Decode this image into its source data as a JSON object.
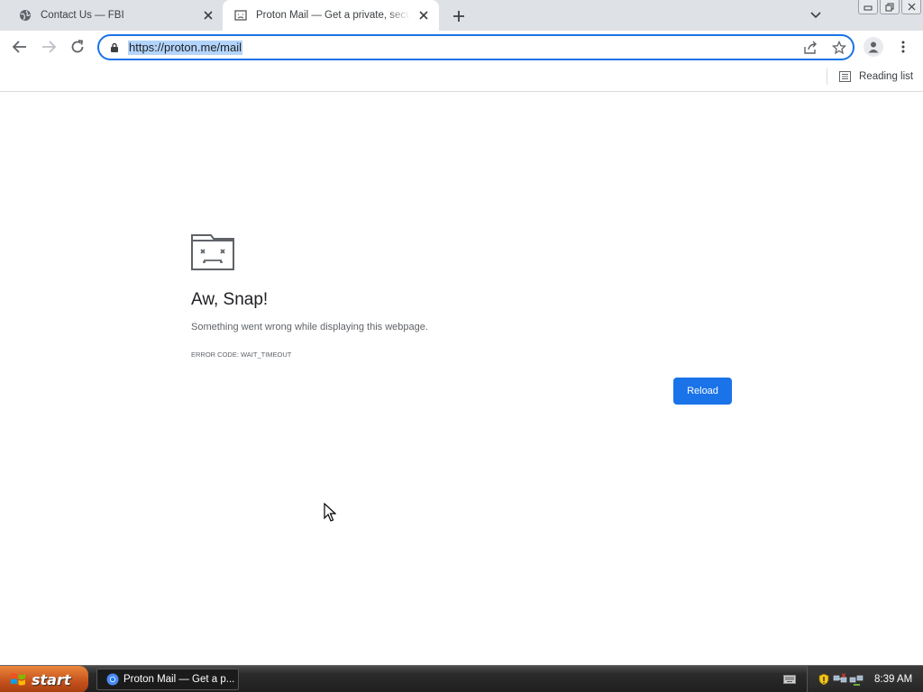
{
  "tabs": [
    {
      "title": "Contact Us — FBI",
      "favicon": "globe-icon",
      "active": false
    },
    {
      "title": "Proton Mail — Get a private, secure, and encrypted email",
      "favicon": "sad-page-icon",
      "active": true
    }
  ],
  "omnibox": {
    "url": "https://proton.me/mail"
  },
  "bookmarks": {
    "reading_list_label": "Reading list"
  },
  "error_page": {
    "title": "Aw, Snap!",
    "message": "Something went wrong while displaying this webpage.",
    "error_code": "Error code: WAIT_TIMEOUT",
    "reload_label": "Reload"
  },
  "taskbar": {
    "start_label": "start",
    "task_label": "Proton Mail — Get a p...",
    "clock": "8:39 AM"
  },
  "colors": {
    "accent": "#1a73e8",
    "tabstrip": "#dee1e6",
    "start_button": "#c4501b"
  }
}
